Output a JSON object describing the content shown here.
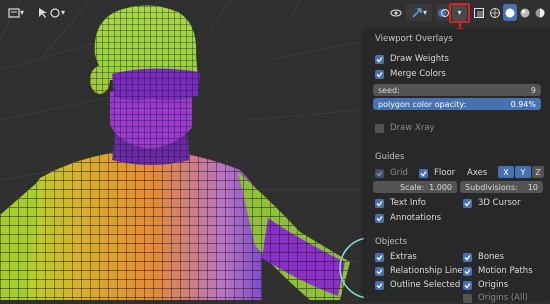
{
  "overlays_panel": {
    "title": "Viewport Overlays",
    "draw_weights": {
      "label": "Draw Weights",
      "checked": true
    },
    "merge_colors": {
      "label": "Merge Colors",
      "checked": true
    },
    "seed": {
      "label": "seed:",
      "value": "9"
    },
    "polygon_opacity": {
      "label": "polygon color opacity:",
      "value": "0.94%"
    },
    "draw_xray": {
      "label": "Draw Xray",
      "checked": false
    },
    "guides": {
      "header": "Guides",
      "grid_label": "Grid",
      "floor_label": "Floor",
      "axes_label": "Axes",
      "axes": [
        "X",
        "Y",
        "Z"
      ],
      "scale_label": "Scale:",
      "scale_value": "1.000",
      "subdivisions_label": "Subdivisions:",
      "subdivisions_value": "10",
      "text_info": "Text Info",
      "cursor_3d": "3D Cursor",
      "annotations": "Annotations"
    },
    "objects": {
      "header": "Objects",
      "extras": "Extras",
      "bones": "Bones",
      "relationship_lines": "Relationship Lines",
      "motion_paths": "Motion Paths",
      "outline_selected": "Outline Selected",
      "origins": "Origins",
      "origins_all": "Origins (All)"
    }
  },
  "colors": {
    "accent": "#4772b3",
    "highlight": "#e02020",
    "panel_bg": "#282828",
    "viewport_bg": "#303030"
  },
  "header_icons": [
    "view-icon",
    "cursor-tool-icon",
    "selectability-icon",
    "gizmo-icon",
    "overlays-icon",
    "overlays-dropdown-icon",
    "xray-icon",
    "shading-wireframe-icon",
    "shading-solid-icon",
    "shading-material-icon",
    "shading-rendered-icon"
  ]
}
